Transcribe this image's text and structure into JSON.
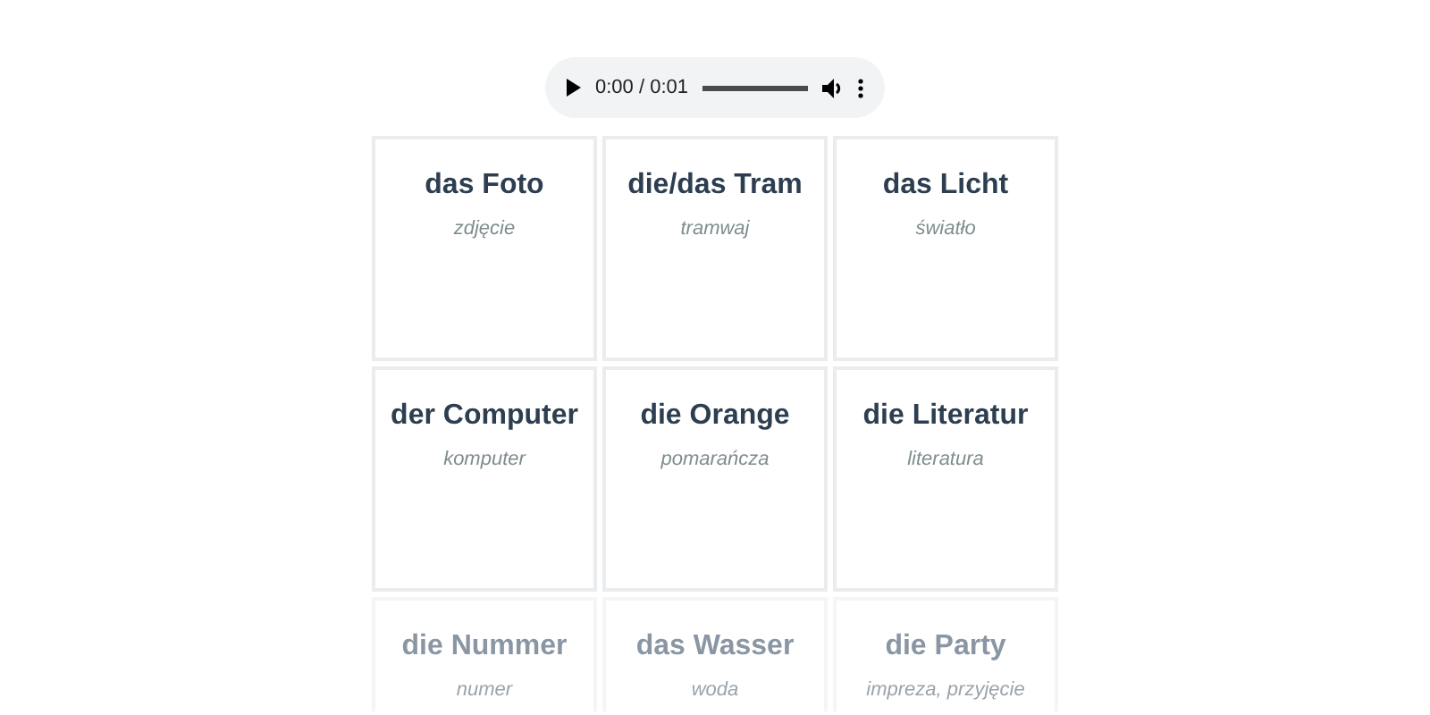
{
  "audio_player": {
    "time": "0:00 / 0:01"
  },
  "cards": [
    {
      "word": "das Foto",
      "translation": "zdjęcie",
      "faded": false
    },
    {
      "word": "die/das Tram",
      "translation": "tramwaj",
      "faded": false
    },
    {
      "word": "das Licht",
      "translation": "światło",
      "faded": false
    },
    {
      "word": "der Computer",
      "translation": "komputer",
      "faded": false
    },
    {
      "word": "die Orange",
      "translation": "pomarańcza",
      "faded": false
    },
    {
      "word": "die Literatur",
      "translation": "literatura",
      "faded": false
    },
    {
      "word": "die Nummer",
      "translation": "numer",
      "faded": true
    },
    {
      "word": "das Wasser",
      "translation": "woda",
      "faded": true
    },
    {
      "word": "die Party",
      "translation": "impreza, przyjęcie",
      "faded": true
    }
  ]
}
